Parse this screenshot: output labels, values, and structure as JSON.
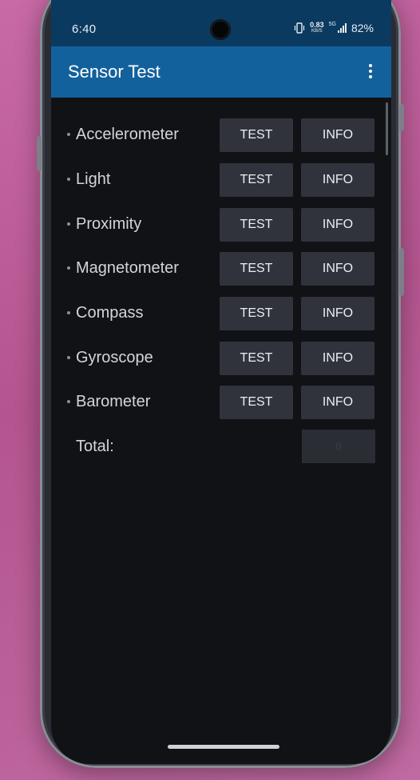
{
  "status_bar": {
    "time": "6:40",
    "net_speed_value": "0.83",
    "net_speed_unit": "KB/S",
    "network_type": "5G",
    "battery": "82%"
  },
  "app_bar": {
    "title": "Sensor Test",
    "menu_icon": "more-vert-icon"
  },
  "sensors": [
    {
      "name": "Accelerometer",
      "test_label": "TEST",
      "info_label": "INFO"
    },
    {
      "name": "Light",
      "test_label": "TEST",
      "info_label": "INFO"
    },
    {
      "name": "Proximity",
      "test_label": "TEST",
      "info_label": "INFO"
    },
    {
      "name": "Magnetometer",
      "test_label": "TEST",
      "info_label": "INFO"
    },
    {
      "name": "Compass",
      "test_label": "TEST",
      "info_label": "INFO"
    },
    {
      "name": "Gyroscope",
      "test_label": "TEST",
      "info_label": "INFO"
    },
    {
      "name": "Barometer",
      "test_label": "TEST",
      "info_label": "INFO"
    }
  ],
  "total": {
    "label": "Total:",
    "value": "0"
  },
  "colors": {
    "status_bar": "#0b3a60",
    "app_bar": "#13619c",
    "background": "#101216",
    "button": "#30333b"
  }
}
